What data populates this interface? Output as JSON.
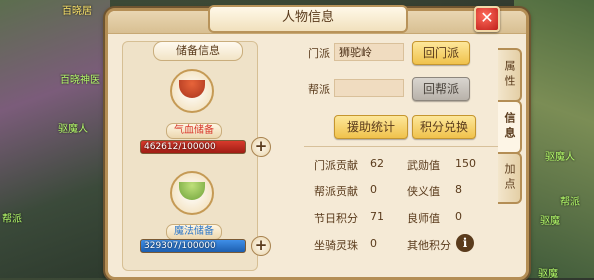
{
  "window": {
    "title": "人物信息"
  },
  "background_names": [
    "百晓居",
    "百晓神医",
    "驱魔人",
    "帮派",
    "驱魔人",
    "帮派",
    "驱魔",
    "驱魔"
  ],
  "storage": {
    "title": "储备信息",
    "hp": {
      "label": "气血储备",
      "value_text": "462612/100000",
      "fill_fraction": 1.0,
      "color": "#d83a2c"
    },
    "mp": {
      "label": "魔法储备",
      "value_text": "329307/100000",
      "fill_fraction": 1.0,
      "color": "#3f8fe8"
    }
  },
  "sect": {
    "label": "门派",
    "value": "狮驼岭",
    "button": "回门派"
  },
  "guild": {
    "label": "帮派",
    "value": "",
    "button": "回帮派"
  },
  "actions": {
    "help_stats": "援助统计",
    "points_exchange": "积分兑换"
  },
  "stats": [
    {
      "label": "门派贡献",
      "value": "62",
      "label2": "武勋值",
      "value2": "150"
    },
    {
      "label": "帮派贡献",
      "value": "0",
      "label2": "侠义值",
      "value2": "8"
    },
    {
      "label": "节日积分",
      "value": "71",
      "label2": "良师值",
      "value2": "0"
    },
    {
      "label": "坐骑灵珠",
      "value": "0",
      "label2": "其他积分",
      "value2": ""
    }
  ],
  "tabs": [
    "属性",
    "信息",
    "加点"
  ],
  "icons": {
    "close": "close-icon",
    "plus": "plus-icon",
    "info": "info-icon",
    "hp_bowl": "red-soup-bowl-icon",
    "mp_bowl": "green-soup-bowl-icon"
  }
}
